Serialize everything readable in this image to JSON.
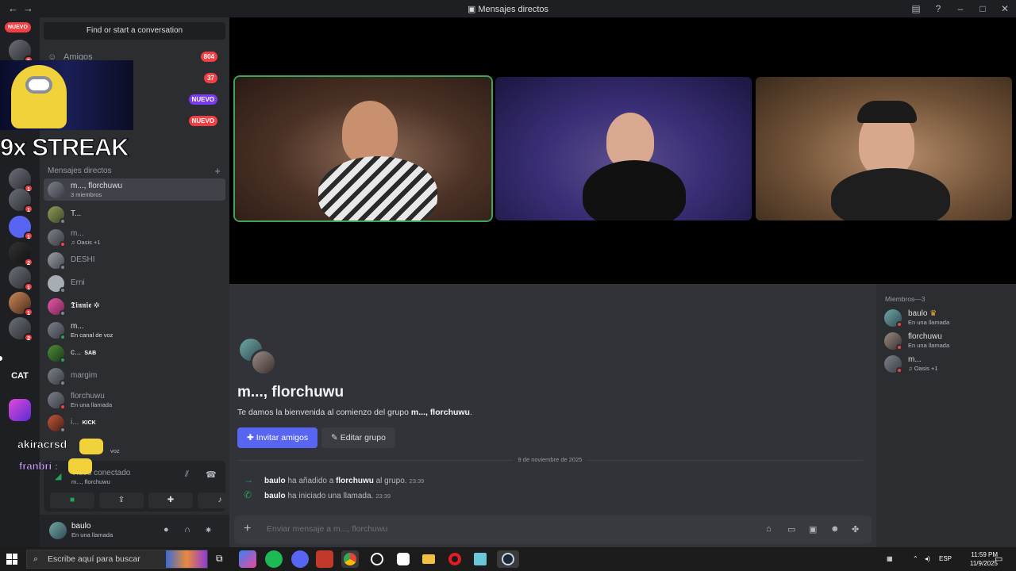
{
  "window": {
    "title": "Mensajes directos",
    "nav_back": "←",
    "nav_forward": "→",
    "icons": [
      "inbox-icon",
      "help-icon",
      "minimize-icon",
      "maximize-icon",
      "close-icon"
    ]
  },
  "rail": {
    "nuevo": "NUEVO",
    "badges": [
      "5",
      "1",
      "1",
      "1",
      "1",
      "2",
      "1",
      "2",
      "2",
      "22",
      "1"
    ],
    "cat_label": "CAT"
  },
  "overlay": {
    "streak": "9x STREAK",
    "chat_user_1": "akiracrsd",
    "chat_user_2": "franbrí :"
  },
  "dm_column": {
    "search": "Find or start a conversation",
    "nav": [
      {
        "label": "Amigos",
        "count": "804"
      },
      {
        "label": "sajes",
        "count": "37"
      },
      {
        "label": "",
        "count": "NUEVO"
      },
      {
        "label": "",
        "count": "NUEVO"
      }
    ],
    "section_header": "Mensajes directos",
    "section_add": "+",
    "dms": [
      {
        "name": "m..., florchuwu",
        "sub": "3 miembros"
      },
      {
        "name": "T...",
        "sub": ""
      },
      {
        "name": "m...",
        "sub": "♫ Oasis +1"
      },
      {
        "name": "DESHI",
        "sub": ""
      },
      {
        "name": "Erni",
        "sub": ""
      },
      {
        "name": "𝕿𝖎𝖓𝖓𝖎𝖊 ✲",
        "sub": ""
      },
      {
        "name": "m...",
        "sub": "En canal de voz"
      },
      {
        "name": "c...",
        "sub": "",
        "tag": "SAB"
      },
      {
        "name": "margim",
        "sub": ""
      },
      {
        "name": "florchuwu",
        "sub": "En una llamada"
      },
      {
        "name": "i...",
        "sub": "",
        "tag": "KICK"
      },
      {
        "name": "",
        "sub": "voz"
      }
    ],
    "voice": {
      "title": "Video conectado",
      "sub": "m..., florchuwu"
    },
    "user": {
      "name": "baulo",
      "status": "En una llamada"
    }
  },
  "chat": {
    "group_name": "m..., florchuwu",
    "welcome_prefix": "Te damos la bienvenida al comienzo del grupo ",
    "welcome_group": "m..., florchuwu",
    "welcome_suffix": ".",
    "invite_button": "Invitar amigos",
    "edit_button": "Editar grupo",
    "date_divider": "9 de noviembre de 2025",
    "events": [
      {
        "user": "baulo",
        "text1": " ha añadido a ",
        "target": "florchuwu",
        "text2": " al grupo.",
        "time": "23:39"
      },
      {
        "user": "baulo",
        "text1": " ha iniciado una llamada.",
        "target": "",
        "text2": "",
        "time": "23:39"
      }
    ],
    "composer_placeholder": "Enviar mensaje a m..., florchuwu"
  },
  "members": {
    "header": "Miembros—3",
    "list": [
      {
        "name": "baulo",
        "sub": "En una llamada",
        "crown": true
      },
      {
        "name": "florchuwu",
        "sub": "En una llamada"
      },
      {
        "name": "m...",
        "sub": "♫ Oasis +1"
      }
    ]
  },
  "taskbar": {
    "search": "Escribe aquí para buscar",
    "lang": "ESP",
    "time": "11:59 PM",
    "date": "11/9/2025"
  },
  "colors": {
    "accent": "#5865f2",
    "online": "#23a55a",
    "danger": "#f23f43",
    "speaking": "#3ba55c"
  }
}
